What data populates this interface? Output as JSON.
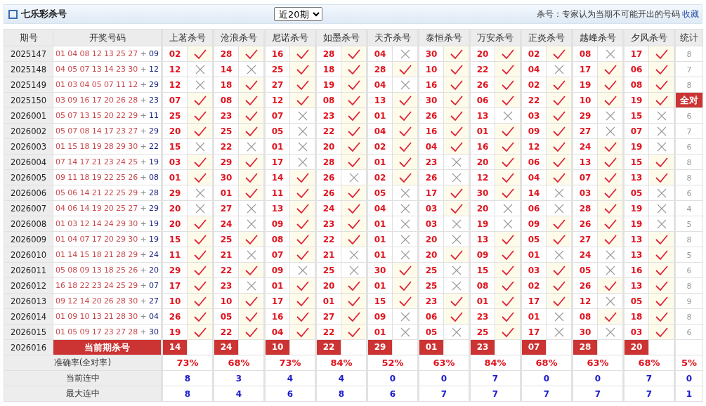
{
  "title": "七乐彩杀号",
  "period_select": {
    "value": "近20期"
  },
  "note": "杀号：专家认为当期不可能开出的号码",
  "bookmark_link": "收藏",
  "columns": {
    "issue": "期号",
    "draw": "开奖号码",
    "experts": [
      "上茗杀号",
      "沧浪杀号",
      "尼诺杀号",
      "如墨杀号",
      "天齐杀号",
      "泰恒杀号",
      "万安杀号",
      "正炎杀号",
      "越峰杀号",
      "夕风杀号"
    ],
    "stat": "统计"
  },
  "rows": [
    {
      "issue": "2025147",
      "reds": [
        "01",
        "04",
        "08",
        "12",
        "13",
        "25",
        "27"
      ],
      "sep": "+",
      "blue": "09",
      "picks": [
        {
          "n": "02",
          "hit": true
        },
        {
          "n": "28",
          "hit": true
        },
        {
          "n": "16",
          "hit": true
        },
        {
          "n": "28",
          "hit": true
        },
        {
          "n": "04",
          "hit": false
        },
        {
          "n": "30",
          "hit": true
        },
        {
          "n": "20",
          "hit": true
        },
        {
          "n": "02",
          "hit": true
        },
        {
          "n": "08",
          "hit": false
        },
        {
          "n": "17",
          "hit": true
        }
      ],
      "stat": "8",
      "perfect": false
    },
    {
      "issue": "2025148",
      "reds": [
        "04",
        "05",
        "07",
        "13",
        "14",
        "23",
        "30"
      ],
      "sep": "+",
      "blue": "12",
      "picks": [
        {
          "n": "12",
          "hit": false
        },
        {
          "n": "14",
          "hit": false
        },
        {
          "n": "25",
          "hit": true
        },
        {
          "n": "18",
          "hit": true
        },
        {
          "n": "28",
          "hit": true
        },
        {
          "n": "10",
          "hit": true
        },
        {
          "n": "22",
          "hit": true
        },
        {
          "n": "04",
          "hit": false
        },
        {
          "n": "17",
          "hit": true
        },
        {
          "n": "06",
          "hit": true
        }
      ],
      "stat": "7",
      "perfect": false
    },
    {
      "issue": "2025149",
      "reds": [
        "01",
        "03",
        "04",
        "05",
        "07",
        "11",
        "12"
      ],
      "sep": "+",
      "blue": "29",
      "picks": [
        {
          "n": "12",
          "hit": false
        },
        {
          "n": "18",
          "hit": true
        },
        {
          "n": "27",
          "hit": true
        },
        {
          "n": "19",
          "hit": true
        },
        {
          "n": "04",
          "hit": false
        },
        {
          "n": "16",
          "hit": true
        },
        {
          "n": "26",
          "hit": true
        },
        {
          "n": "02",
          "hit": true
        },
        {
          "n": "19",
          "hit": true
        },
        {
          "n": "08",
          "hit": true
        }
      ],
      "stat": "8",
      "perfect": false
    },
    {
      "issue": "2025150",
      "reds": [
        "03",
        "09",
        "16",
        "17",
        "20",
        "26",
        "28"
      ],
      "sep": "+",
      "blue": "23",
      "picks": [
        {
          "n": "07",
          "hit": true
        },
        {
          "n": "08",
          "hit": true
        },
        {
          "n": "12",
          "hit": true
        },
        {
          "n": "08",
          "hit": true
        },
        {
          "n": "13",
          "hit": true
        },
        {
          "n": "30",
          "hit": true
        },
        {
          "n": "06",
          "hit": true
        },
        {
          "n": "22",
          "hit": true
        },
        {
          "n": "10",
          "hit": true
        },
        {
          "n": "19",
          "hit": true
        }
      ],
      "stat": "全对",
      "perfect": true
    },
    {
      "issue": "2026001",
      "reds": [
        "05",
        "07",
        "13",
        "15",
        "20",
        "22",
        "29"
      ],
      "sep": "+",
      "blue": "11",
      "picks": [
        {
          "n": "25",
          "hit": true
        },
        {
          "n": "23",
          "hit": true
        },
        {
          "n": "07",
          "hit": false
        },
        {
          "n": "23",
          "hit": true
        },
        {
          "n": "01",
          "hit": true
        },
        {
          "n": "26",
          "hit": true
        },
        {
          "n": "13",
          "hit": false
        },
        {
          "n": "03",
          "hit": true
        },
        {
          "n": "29",
          "hit": false
        },
        {
          "n": "15",
          "hit": false
        }
      ],
      "stat": "6",
      "perfect": false
    },
    {
      "issue": "2026002",
      "reds": [
        "05",
        "07",
        "08",
        "14",
        "17",
        "23",
        "27"
      ],
      "sep": "+",
      "blue": "29",
      "picks": [
        {
          "n": "20",
          "hit": true
        },
        {
          "n": "25",
          "hit": true
        },
        {
          "n": "05",
          "hit": false
        },
        {
          "n": "22",
          "hit": true
        },
        {
          "n": "04",
          "hit": true
        },
        {
          "n": "16",
          "hit": true
        },
        {
          "n": "01",
          "hit": true
        },
        {
          "n": "09",
          "hit": true
        },
        {
          "n": "27",
          "hit": false
        },
        {
          "n": "07",
          "hit": false
        }
      ],
      "stat": "7",
      "perfect": false
    },
    {
      "issue": "2026003",
      "reds": [
        "01",
        "15",
        "18",
        "19",
        "28",
        "29",
        "30"
      ],
      "sep": "+",
      "blue": "22",
      "picks": [
        {
          "n": "15",
          "hit": false
        },
        {
          "n": "22",
          "hit": false
        },
        {
          "n": "01",
          "hit": false
        },
        {
          "n": "20",
          "hit": true
        },
        {
          "n": "02",
          "hit": true
        },
        {
          "n": "04",
          "hit": true
        },
        {
          "n": "16",
          "hit": true
        },
        {
          "n": "12",
          "hit": true
        },
        {
          "n": "24",
          "hit": true
        },
        {
          "n": "19",
          "hit": false
        }
      ],
      "stat": "6",
      "perfect": false
    },
    {
      "issue": "2026004",
      "reds": [
        "07",
        "14",
        "17",
        "21",
        "23",
        "24",
        "25"
      ],
      "sep": "+",
      "blue": "19",
      "picks": [
        {
          "n": "03",
          "hit": true
        },
        {
          "n": "29",
          "hit": true
        },
        {
          "n": "17",
          "hit": false
        },
        {
          "n": "28",
          "hit": true
        },
        {
          "n": "01",
          "hit": true
        },
        {
          "n": "23",
          "hit": false
        },
        {
          "n": "20",
          "hit": true
        },
        {
          "n": "06",
          "hit": true
        },
        {
          "n": "13",
          "hit": true
        },
        {
          "n": "15",
          "hit": true
        }
      ],
      "stat": "8",
      "perfect": false
    },
    {
      "issue": "2026005",
      "reds": [
        "09",
        "11",
        "18",
        "19",
        "22",
        "25",
        "26"
      ],
      "sep": "+",
      "blue": "08",
      "picks": [
        {
          "n": "01",
          "hit": true
        },
        {
          "n": "30",
          "hit": true
        },
        {
          "n": "14",
          "hit": true
        },
        {
          "n": "26",
          "hit": false
        },
        {
          "n": "02",
          "hit": true
        },
        {
          "n": "26",
          "hit": false
        },
        {
          "n": "12",
          "hit": true
        },
        {
          "n": "04",
          "hit": true
        },
        {
          "n": "07",
          "hit": true
        },
        {
          "n": "13",
          "hit": true
        }
      ],
      "stat": "8",
      "perfect": false
    },
    {
      "issue": "2026006",
      "reds": [
        "05",
        "06",
        "14",
        "21",
        "22",
        "25",
        "29"
      ],
      "sep": "+",
      "blue": "28",
      "picks": [
        {
          "n": "29",
          "hit": false
        },
        {
          "n": "01",
          "hit": true
        },
        {
          "n": "11",
          "hit": true
        },
        {
          "n": "26",
          "hit": true
        },
        {
          "n": "05",
          "hit": false
        },
        {
          "n": "17",
          "hit": true
        },
        {
          "n": "30",
          "hit": true
        },
        {
          "n": "14",
          "hit": false
        },
        {
          "n": "03",
          "hit": true
        },
        {
          "n": "05",
          "hit": false
        }
      ],
      "stat": "6",
      "perfect": false
    },
    {
      "issue": "2026007",
      "reds": [
        "04",
        "06",
        "14",
        "19",
        "20",
        "25",
        "27"
      ],
      "sep": "+",
      "blue": "29",
      "picks": [
        {
          "n": "20",
          "hit": false
        },
        {
          "n": "27",
          "hit": false
        },
        {
          "n": "13",
          "hit": true
        },
        {
          "n": "24",
          "hit": true
        },
        {
          "n": "04",
          "hit": false
        },
        {
          "n": "03",
          "hit": true
        },
        {
          "n": "20",
          "hit": false
        },
        {
          "n": "06",
          "hit": false
        },
        {
          "n": "28",
          "hit": true
        },
        {
          "n": "19",
          "hit": false
        }
      ],
      "stat": "4",
      "perfect": false
    },
    {
      "issue": "2026008",
      "reds": [
        "01",
        "03",
        "12",
        "14",
        "24",
        "29",
        "30"
      ],
      "sep": "+",
      "blue": "19",
      "picks": [
        {
          "n": "20",
          "hit": true
        },
        {
          "n": "24",
          "hit": false
        },
        {
          "n": "09",
          "hit": true
        },
        {
          "n": "23",
          "hit": true
        },
        {
          "n": "01",
          "hit": false
        },
        {
          "n": "03",
          "hit": false
        },
        {
          "n": "19",
          "hit": false
        },
        {
          "n": "09",
          "hit": true
        },
        {
          "n": "26",
          "hit": true
        },
        {
          "n": "19",
          "hit": false
        }
      ],
      "stat": "5",
      "perfect": false
    },
    {
      "issue": "2026009",
      "reds": [
        "01",
        "04",
        "07",
        "17",
        "20",
        "29",
        "30"
      ],
      "sep": "+",
      "blue": "19",
      "picks": [
        {
          "n": "15",
          "hit": true
        },
        {
          "n": "25",
          "hit": true
        },
        {
          "n": "08",
          "hit": true
        },
        {
          "n": "22",
          "hit": true
        },
        {
          "n": "01",
          "hit": false
        },
        {
          "n": "20",
          "hit": false
        },
        {
          "n": "13",
          "hit": true
        },
        {
          "n": "05",
          "hit": true
        },
        {
          "n": "27",
          "hit": true
        },
        {
          "n": "13",
          "hit": true
        }
      ],
      "stat": "8",
      "perfect": false
    },
    {
      "issue": "2026010",
      "reds": [
        "01",
        "14",
        "15",
        "18",
        "21",
        "28",
        "29"
      ],
      "sep": "+",
      "blue": "24",
      "picks": [
        {
          "n": "11",
          "hit": true
        },
        {
          "n": "21",
          "hit": false
        },
        {
          "n": "07",
          "hit": true
        },
        {
          "n": "21",
          "hit": false
        },
        {
          "n": "01",
          "hit": false
        },
        {
          "n": "20",
          "hit": true
        },
        {
          "n": "09",
          "hit": true
        },
        {
          "n": "01",
          "hit": false
        },
        {
          "n": "24",
          "hit": false
        },
        {
          "n": "13",
          "hit": true
        }
      ],
      "stat": "5",
      "perfect": false
    },
    {
      "issue": "2026011",
      "reds": [
        "05",
        "08",
        "09",
        "13",
        "18",
        "25",
        "26"
      ],
      "sep": "+",
      "blue": "20",
      "picks": [
        {
          "n": "29",
          "hit": true
        },
        {
          "n": "22",
          "hit": true
        },
        {
          "n": "09",
          "hit": false
        },
        {
          "n": "25",
          "hit": false
        },
        {
          "n": "30",
          "hit": true
        },
        {
          "n": "25",
          "hit": false
        },
        {
          "n": "15",
          "hit": true
        },
        {
          "n": "03",
          "hit": true
        },
        {
          "n": "05",
          "hit": false
        },
        {
          "n": "16",
          "hit": true
        }
      ],
      "stat": "6",
      "perfect": false
    },
    {
      "issue": "2026012",
      "reds": [
        "16",
        "18",
        "22",
        "23",
        "24",
        "25",
        "29"
      ],
      "sep": "+",
      "blue": "07",
      "picks": [
        {
          "n": "17",
          "hit": true
        },
        {
          "n": "23",
          "hit": false
        },
        {
          "n": "01",
          "hit": true
        },
        {
          "n": "20",
          "hit": true
        },
        {
          "n": "01",
          "hit": true
        },
        {
          "n": "25",
          "hit": false
        },
        {
          "n": "08",
          "hit": true
        },
        {
          "n": "02",
          "hit": true
        },
        {
          "n": "26",
          "hit": true
        },
        {
          "n": "13",
          "hit": true
        }
      ],
      "stat": "8",
      "perfect": false
    },
    {
      "issue": "2026013",
      "reds": [
        "09",
        "12",
        "14",
        "20",
        "26",
        "28",
        "30"
      ],
      "sep": "+",
      "blue": "27",
      "picks": [
        {
          "n": "10",
          "hit": true
        },
        {
          "n": "10",
          "hit": true
        },
        {
          "n": "17",
          "hit": true
        },
        {
          "n": "01",
          "hit": true
        },
        {
          "n": "15",
          "hit": true
        },
        {
          "n": "23",
          "hit": true
        },
        {
          "n": "01",
          "hit": true
        },
        {
          "n": "17",
          "hit": true
        },
        {
          "n": "12",
          "hit": false
        },
        {
          "n": "05",
          "hit": true
        }
      ],
      "stat": "9",
      "perfect": false
    },
    {
      "issue": "2026014",
      "reds": [
        "01",
        "09",
        "10",
        "13",
        "21",
        "28",
        "30"
      ],
      "sep": "+",
      "blue": "04",
      "picks": [
        {
          "n": "26",
          "hit": true
        },
        {
          "n": "05",
          "hit": true
        },
        {
          "n": "16",
          "hit": true
        },
        {
          "n": "27",
          "hit": true
        },
        {
          "n": "09",
          "hit": false
        },
        {
          "n": "06",
          "hit": true
        },
        {
          "n": "23",
          "hit": true
        },
        {
          "n": "01",
          "hit": false
        },
        {
          "n": "08",
          "hit": true
        },
        {
          "n": "18",
          "hit": true
        }
      ],
      "stat": "8",
      "perfect": false
    },
    {
      "issue": "2026015",
      "reds": [
        "01",
        "05",
        "09",
        "17",
        "23",
        "27",
        "28"
      ],
      "sep": "+",
      "blue": "30",
      "picks": [
        {
          "n": "19",
          "hit": true
        },
        {
          "n": "22",
          "hit": true
        },
        {
          "n": "04",
          "hit": true
        },
        {
          "n": "22",
          "hit": true
        },
        {
          "n": "01",
          "hit": false
        },
        {
          "n": "05",
          "hit": false
        },
        {
          "n": "25",
          "hit": true
        },
        {
          "n": "17",
          "hit": false
        },
        {
          "n": "30",
          "hit": false
        },
        {
          "n": "03",
          "hit": true
        }
      ],
      "stat": "6",
      "perfect": false
    }
  ],
  "current": {
    "issue": "2026016",
    "label": "当前期杀号",
    "picks": [
      "14",
      "24",
      "10",
      "22",
      "29",
      "01",
      "23",
      "07",
      "28",
      "20"
    ]
  },
  "summary": [
    {
      "kind": "rate",
      "label": "准确率(全对率)",
      "values": [
        "73%",
        "68%",
        "73%",
        "84%",
        "52%",
        "63%",
        "84%",
        "68%",
        "63%",
        "68%"
      ],
      "stat": "5%"
    },
    {
      "kind": "count",
      "label": "当前连中",
      "values": [
        "8",
        "3",
        "4",
        "4",
        "0",
        "0",
        "7",
        "0",
        "0",
        "7"
      ],
      "stat": "0"
    },
    {
      "kind": "count",
      "label": "最大连中",
      "values": [
        "8",
        "4",
        "6",
        "8",
        "6",
        "7",
        "7",
        "7",
        "7",
        "7"
      ],
      "stat": "1"
    }
  ]
}
